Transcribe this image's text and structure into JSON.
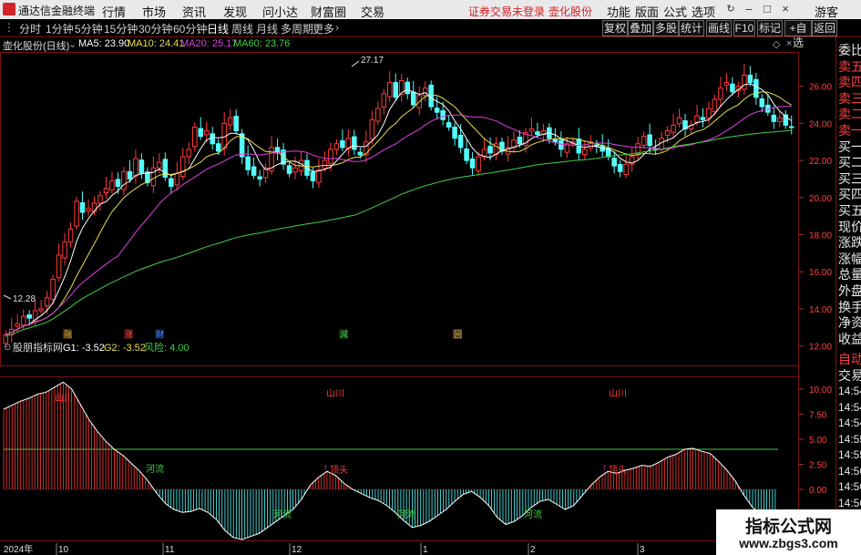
{
  "app": {
    "title": "通达信金融终端",
    "menu": [
      "行情",
      "市场",
      "资讯",
      "发现",
      "问小达",
      "财富圈",
      "交易"
    ],
    "login_status": "证券交易未登录",
    "stock_link": "壶化股份",
    "menu_right": [
      "功能",
      "版面",
      "公式",
      "选项"
    ],
    "user": "游客"
  },
  "tabs": [
    "分时",
    "1分钟",
    "5分钟",
    "15分钟",
    "30分钟",
    "60分钟",
    "日线",
    "周线",
    "月线",
    "多周期",
    "更多"
  ],
  "active_tab": "日线",
  "right_buttons": [
    "复权",
    "叠加",
    "多股",
    "统计",
    "画线",
    "F10",
    "标记",
    "+自选",
    "返回"
  ],
  "main_header": {
    "stock": "壶化股份(日线)",
    "ma": [
      {
        "label": "MA5: 23.90",
        "color": "#ffffff"
      },
      {
        "label": "MA10: 24.41",
        "color": "#e8e04a"
      },
      {
        "label": "MA20: 25.17",
        "color": "#e040e0"
      },
      {
        "label": "MA60: 23.76",
        "color": "#40d040"
      }
    ]
  },
  "price_axis": [
    "26.00",
    "24.00",
    "22.00",
    "20.00",
    "18.00",
    "16.00",
    "14.00",
    "12.00"
  ],
  "annotations": {
    "high": "27.17",
    "low": "12.28"
  },
  "event_markers": [
    {
      "text": "融",
      "color": "#d4a24a"
    },
    {
      "text": "涨",
      "color": "#ff5050"
    },
    {
      "text": "财",
      "color": "#5090ff"
    },
    {
      "text": "減",
      "color": "#40d040"
    },
    {
      "text": "回",
      "color": "#e8c070"
    }
  ],
  "indicator_header": {
    "name": "股朋指标网",
    "g1": "G1: -3.52",
    "g2": "G2: -3.52",
    "risk": "风险: 4.00",
    "colors": {
      "g1": "#ffffff",
      "g2": "#e8e04a",
      "risk": "#40d040"
    }
  },
  "indicator_axis": [
    "10.00",
    "7.50",
    "5.00",
    "2.50",
    "0.00"
  ],
  "indicator_labels": {
    "mountain": [
      "山川",
      "山川",
      "山川"
    ],
    "river": [
      "河流",
      "河流",
      "河流",
      "河流"
    ],
    "top": [
      "顶头",
      "顶头"
    ]
  },
  "time_axis": [
    "2024年",
    "10",
    "11",
    "12",
    "1",
    "2",
    "3"
  ],
  "right_panel": {
    "order_book": [
      "委比",
      "卖五",
      "卖四",
      "卖三",
      "卖二",
      "卖一",
      "买一",
      "买二",
      "买三",
      "买四",
      "买五",
      "现价",
      "涨跌",
      "涨幅",
      "总量",
      "外盘",
      "换手",
      "净资",
      "收益"
    ],
    "bottom": [
      "自动",
      "交易"
    ],
    "times": [
      "14:54",
      "14:54",
      "14:54",
      "14:55",
      "14:55",
      "14:56",
      "14:56",
      "14:56"
    ]
  },
  "watermark": {
    "title": "指标公式网",
    "url": "www.zbgs3.com"
  },
  "colors": {
    "up": "#ff3a3a",
    "down": "#54fcfc",
    "frame": "#7a1010"
  },
  "chart_data": [
    {
      "type": "candlestick",
      "title": "壶化股份(日线)",
      "y_range": [
        11.0,
        27.8
      ],
      "summary": {
        "high": 27.17,
        "low": 12.28
      },
      "moving_averages": {
        "MA5": 23.9,
        "MA10": 24.41,
        "MA20": 25.17,
        "MA60": 23.76
      },
      "close_series": [
        12.6,
        12.9,
        13.2,
        13.6,
        13.5,
        13.9,
        14.0,
        14.6,
        15.6,
        16.9,
        17.6,
        18.3,
        19.8,
        19.2,
        19.4,
        19.7,
        20.1,
        20.5,
        20.9,
        20.6,
        21.4,
        21.0,
        22.1,
        21.3,
        20.8,
        21.6,
        21.9,
        21.1,
        20.6,
        21.3,
        22.2,
        22.6,
        23.8,
        23.3,
        23.6,
        22.9,
        22.5,
        24.0,
        24.3,
        23.6,
        22.2,
        21.5,
        21.2,
        21.0,
        21.6,
        22.7,
        22.4,
        21.8,
        21.3,
        21.6,
        22.0,
        21.2,
        20.9,
        21.5,
        22.0,
        22.6,
        22.9,
        22.7,
        23.2,
        22.6,
        22.3,
        23.0,
        24.2,
        24.8,
        25.6,
        26.2,
        25.4,
        26.3,
        25.6,
        25.0,
        25.5,
        25.9,
        24.9,
        24.6,
        24.2,
        23.8,
        23.2,
        22.7,
        22.0,
        21.6,
        22.2,
        22.6,
        22.4,
        22.9,
        22.5,
        22.7,
        23.1,
        22.9,
        23.5,
        23.7,
        23.4,
        23.6,
        23.2,
        23.0,
        22.6,
        22.9,
        23.0,
        22.4,
        22.6,
        23.0,
        22.8,
        22.5,
        22.2,
        21.7,
        21.4,
        21.8,
        22.2,
        22.9,
        23.3,
        22.8,
        22.6,
        23.2,
        23.6,
        23.9,
        24.3,
        23.7,
        23.9,
        24.4,
        24.2,
        24.8,
        25.3,
        25.9,
        26.2,
        25.7,
        26.0,
        26.6,
        26.2,
        25.4,
        24.9,
        24.6,
        24.1,
        24.3,
        23.9,
        23.8
      ]
    },
    {
      "type": "area",
      "title": "股朋指标网",
      "y_range": [
        -5.0,
        11.0
      ],
      "risk_level": 4.0,
      "values": [
        8.0,
        8.4,
        8.8,
        9.1,
        9.5,
        9.7,
        10.2,
        10.7,
        10.0,
        8.5,
        7.0,
        5.8,
        4.8,
        4.0,
        3.4,
        2.6,
        1.8,
        0.8,
        -0.4,
        -1.4,
        -2.0,
        -2.3,
        -2.2,
        -1.9,
        -2.3,
        -3.0,
        -4.1,
        -4.8,
        -5.0,
        -4.7,
        -4.4,
        -3.8,
        -3.2,
        -2.6,
        -2.0,
        -1.0,
        0.4,
        1.2,
        1.8,
        1.4,
        0.6,
        0.0,
        -0.4,
        -0.8,
        -1.1,
        -1.6,
        -2.3,
        -3.1,
        -3.8,
        -3.6,
        -3.2,
        -2.6,
        -2.0,
        -1.2,
        -0.5,
        -0.2,
        -0.8,
        -1.6,
        -2.8,
        -3.5,
        -3.2,
        -2.6,
        -1.8,
        -1.2,
        -1.0,
        -1.5,
        -2.0,
        -1.6,
        -0.6,
        0.4,
        1.2,
        1.8,
        1.6,
        1.9,
        2.1,
        2.4,
        2.3,
        2.7,
        3.2,
        3.5,
        4.0,
        4.1,
        3.8,
        3.6,
        2.8,
        1.9,
        0.8,
        -0.6,
        -1.8,
        -2.6,
        -2.8,
        -2.8
      ]
    }
  ]
}
